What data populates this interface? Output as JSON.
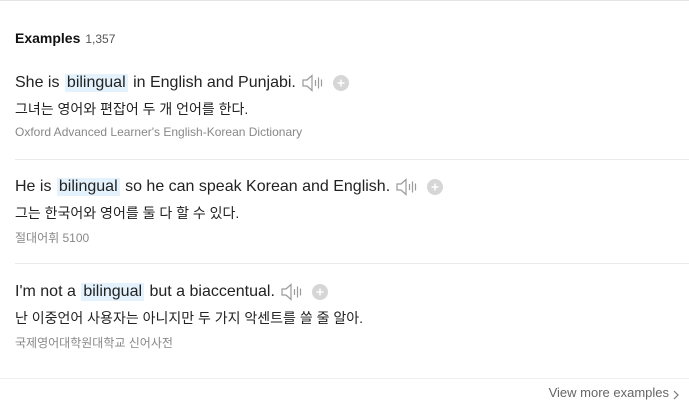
{
  "header": {
    "title": "Examples",
    "count": "1,357"
  },
  "examples": [
    {
      "before": "She is ",
      "highlight": "bilingual",
      "after": " in English and Punjabi.",
      "translation": "그녀는 영어와 편잡어 두 개 언어를 한다.",
      "source": "Oxford Advanced Learner's English-Korean Dictionary"
    },
    {
      "before": "He is ",
      "highlight": "bilingual",
      "after": " so he can speak Korean and English.",
      "translation": "그는 한국어와 영어를 둘 다 할 수 있다.",
      "source": "절대어휘 5100"
    },
    {
      "before": "I'm not a ",
      "highlight": "bilingual",
      "after": " but a biaccentual.",
      "translation": "난 이중언어 사용자는 아니지만 두 가지 악센트를 쓸 줄 알아.",
      "source": "국제영어대학원대학교 신어사전"
    }
  ],
  "footer": {
    "more_label": "View more examples"
  },
  "icons": {
    "speaker": "speaker-icon",
    "add": "plus-circle-icon",
    "more": "chevron-right-icon"
  },
  "colors": {
    "highlight_bg": "#e3f2fc",
    "icon_gray": "#9a9a9a"
  }
}
